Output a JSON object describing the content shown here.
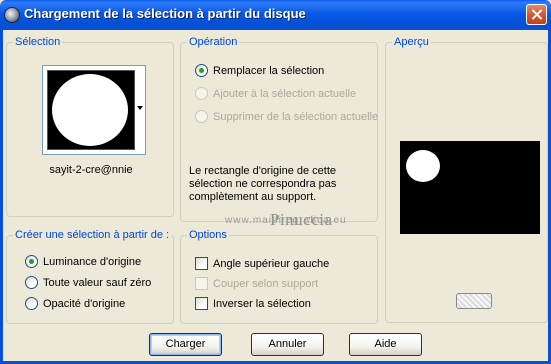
{
  "window": {
    "title": "Chargement de la sélection à partir du disque"
  },
  "selection_group": {
    "title": "Sélection",
    "file_name": "sayit-2-cre@nnie"
  },
  "operation_group": {
    "title": "Opération",
    "options": [
      {
        "label": "Remplacer la sélection",
        "checked": true,
        "enabled": true
      },
      {
        "label": "Ajouter à la sélection actuelle",
        "checked": false,
        "enabled": false
      },
      {
        "label": "Supprimer de la sélection actuelle",
        "checked": false,
        "enabled": false
      }
    ],
    "message": "Le rectangle d'origine de cette sélection ne correspondra pas complètement au support."
  },
  "apercu_group": {
    "title": "Aperçu"
  },
  "create_group": {
    "title": "Créer une sélection à partir de :",
    "options": [
      {
        "label": "Luminance d'origine",
        "checked": true
      },
      {
        "label": "Toute valeur sauf zéro",
        "checked": false
      },
      {
        "label": "Opacité d'origine",
        "checked": false
      }
    ]
  },
  "options_group": {
    "title": "Options",
    "checks": [
      {
        "label": "Angle supérieur gauche",
        "checked": false,
        "enabled": true
      },
      {
        "label": "Couper selon support",
        "checked": false,
        "enabled": false
      },
      {
        "label": "Inverser la sélection",
        "checked": false,
        "enabled": true
      }
    ]
  },
  "watermark": {
    "title": "Pinuccia",
    "url": "www.maidiregrafica.eu"
  },
  "buttons": {
    "load": "Charger",
    "cancel": "Annuler",
    "help": "Aide"
  }
}
